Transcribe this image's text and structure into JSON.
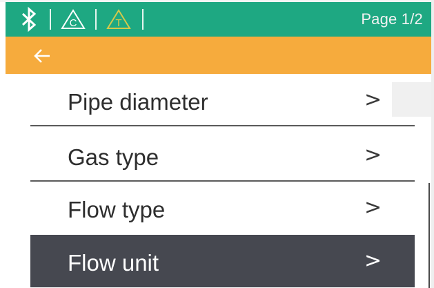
{
  "status_bar": {
    "icons": [
      "bluetooth-icon",
      "c-triangle-icon",
      "t-triangle-icon"
    ],
    "page_indicator": "Page 1/2",
    "color": "#1ea882"
  },
  "title_bar": {
    "back_icon": "back-arrow-icon",
    "color": "#f6ab3d"
  },
  "menu": {
    "items": [
      {
        "label": "Pipe diameter",
        "chevron": ">"
      },
      {
        "label": "Gas type",
        "chevron": ">"
      },
      {
        "label": "Flow type",
        "chevron": ">"
      },
      {
        "label": "Flow unit",
        "chevron": ">",
        "selected": true
      }
    ],
    "selected_color": "#464850"
  }
}
